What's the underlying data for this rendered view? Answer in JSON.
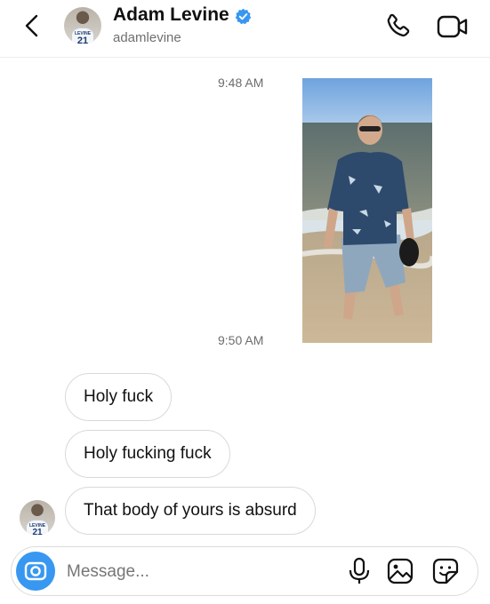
{
  "header": {
    "name": "Adam Levine",
    "handle": "adamlevine",
    "avatar_jersey_text": "LEVINE",
    "avatar_jersey_number": "21",
    "icons": {
      "back": "chevron-left-icon",
      "verified": "verified-badge-icon",
      "call": "phone-icon",
      "video": "video-camera-icon"
    }
  },
  "thread": {
    "timestamps": [
      "9:48 AM",
      "9:50 AM"
    ],
    "photo": {
      "description_icon": "photo-message"
    },
    "messages": [
      {
        "text": "Holy fuck"
      },
      {
        "text": "Holy fucking fuck"
      },
      {
        "text": "That body of yours is absurd"
      }
    ]
  },
  "composer": {
    "placeholder": "Message...",
    "icons": {
      "camera": "camera-icon",
      "mic": "microphone-icon",
      "gallery": "gallery-icon",
      "sticker": "sticker-icon"
    }
  },
  "colors": {
    "accent": "#3897f0",
    "verified": "#3797f0",
    "bubble_border": "#d9d9d9",
    "muted_text": "#6c6c6c"
  }
}
